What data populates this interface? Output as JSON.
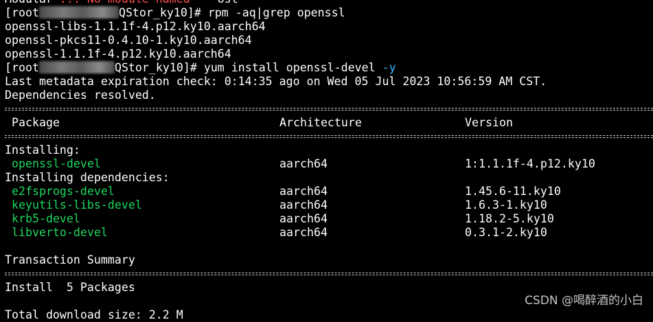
{
  "colors": {
    "background": "#000000",
    "text": "#ffffff",
    "package_name": "#1ed760",
    "error_text": "#ff4d4d",
    "highlight_flag": "#3ab7ff"
  },
  "lines": {
    "line0_a": "Modular ",
    "line0_err": "... No module named ",
    "line0_b": "   ost",
    "rpm_prompt_start": "[root",
    "rpm_prompt_end": "QStor_ky10]# ",
    "rpm_cmd": "rpm -aq|grep openssl",
    "rpm_out_1": "openssl-libs-1.1.1f-4.p12.ky10.aarch64",
    "rpm_out_2": "openssl-pkcs11-0.4.10-1.ky10.aarch64",
    "rpm_out_3": "openssl-1.1.1f-4.p12.ky10.aarch64",
    "yum_prompt_start": "[root",
    "yum_prompt_end": "QStor_ky10]# ",
    "yum_cmd": "yum install openssl-devel ",
    "yum_flag": "-y",
    "metadata": "Last metadata expiration check: 0:14:35 ago on Wed 05 Jul 2023 10:56:59 AM CST.",
    "deps_resolved": "Dependencies resolved."
  },
  "table": {
    "headers": {
      "package": "Package",
      "architecture": "Architecture",
      "version": "Version"
    },
    "installing_label": "Installing:",
    "installing": [
      {
        "name": "openssl-devel",
        "arch": "aarch64",
        "version": "1:1.1.1f-4.p12.ky10"
      }
    ],
    "deps_label": "Installing dependencies:",
    "dependencies": [
      {
        "name": "e2fsprogs-devel",
        "arch": "aarch64",
        "version": "1.45.6-11.ky10"
      },
      {
        "name": "keyutils-libs-devel",
        "arch": "aarch64",
        "version": "1.6.3-1.ky10"
      },
      {
        "name": "krb5-devel",
        "arch": "aarch64",
        "version": "1.18.2-5.ky10"
      },
      {
        "name": "libverto-devel",
        "arch": "aarch64",
        "version": "0.3.1-2.ky10"
      }
    ]
  },
  "summary": {
    "title": "Transaction Summary",
    "install": "Install  5 Packages",
    "download": "Total download size: 2.2 M"
  },
  "watermark": "CSDN @喝醉酒的小白"
}
